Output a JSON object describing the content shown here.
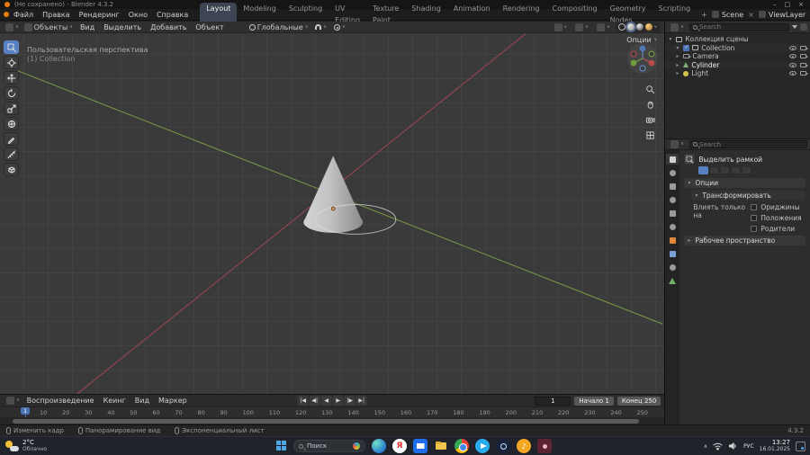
{
  "icons": {
    "caret": "∨",
    "close": "×",
    "check": "✓",
    "collapsed": "▸",
    "expanded": "▾"
  },
  "titlebar": {
    "title": "(Не сохранено) - Blender 4.3.2",
    "controls": [
      "–",
      "□",
      "×"
    ]
  },
  "topbar": {
    "menus": [
      "Файл",
      "Правка",
      "Рендеринг",
      "Окно",
      "Справка"
    ],
    "tabs": [
      {
        "label": "Layout",
        "active": true
      },
      {
        "label": "Modeling"
      },
      {
        "label": "Sculpting"
      },
      {
        "label": "UV Editing"
      },
      {
        "label": "Texture Paint"
      },
      {
        "label": "Shading"
      },
      {
        "label": "Animation"
      },
      {
        "label": "Rendering"
      },
      {
        "label": "Compositing"
      },
      {
        "label": "Geometry Nodes"
      },
      {
        "label": "Scripting"
      }
    ],
    "add_tab": "+",
    "scene_label": "Scene",
    "viewlayer_label": "ViewLayer"
  },
  "viewport_header": {
    "mode": "Объекты",
    "menus": [
      "Вид",
      "Выделить",
      "Добавить",
      "Объект"
    ],
    "orientation": "Глобальные"
  },
  "viewport": {
    "perspective_label": "Пользовательская перспектива",
    "collection_label": "(1) Collection",
    "options_label": "Опции"
  },
  "outliner": {
    "search_placeholder": "Search",
    "scene_collection": "Коллекция сцены",
    "items": [
      {
        "name": "Collection"
      },
      {
        "name": "Camera"
      },
      {
        "name": "Cylinder"
      },
      {
        "name": "Light"
      }
    ]
  },
  "properties": {
    "search_placeholder": "Search",
    "tool_name": "Выделить рамкой",
    "options_panel": "Опции",
    "transform_panel": "Трансформировать",
    "affect_only_label": "Влиять только на",
    "checkboxes": [
      "Ориджины",
      "Положения",
      "Родители"
    ],
    "workspace_panel": "Рабочее пространство"
  },
  "timeline": {
    "menus": [
      "Воспроизведение",
      "Кеинг",
      "Вид",
      "Маркер"
    ],
    "transport": [
      "|◀",
      "◀|",
      "◀",
      "▶",
      "|▶",
      "▶|"
    ],
    "current_frame": "1",
    "start_field": "Начало 1",
    "end_field": "Конец 250",
    "ruler": [
      "10",
      "20",
      "30",
      "40",
      "50",
      "60",
      "70",
      "80",
      "90",
      "100",
      "110",
      "120",
      "130",
      "140",
      "150",
      "160",
      "170",
      "180",
      "190",
      "200",
      "210",
      "220",
      "230",
      "240",
      "250"
    ]
  },
  "statusbar": {
    "hints": [
      "Изменить кадр",
      "Панорамирование вид",
      "Экспоненциальный лист"
    ],
    "version": "4.3.2"
  },
  "taskbar": {
    "weather_temp": "2°C",
    "weather_desc": "Облачно",
    "search_placeholder": "Поиск",
    "yandex_letter": "Я",
    "music_note": "♪",
    "chevron": "∧",
    "language": "РУС",
    "time": "13:27",
    "date": "16.01.2025"
  },
  "colors": {
    "accent": "#4772b3",
    "axis_x": "#9e4553",
    "axis_y": "#7a9a49"
  }
}
